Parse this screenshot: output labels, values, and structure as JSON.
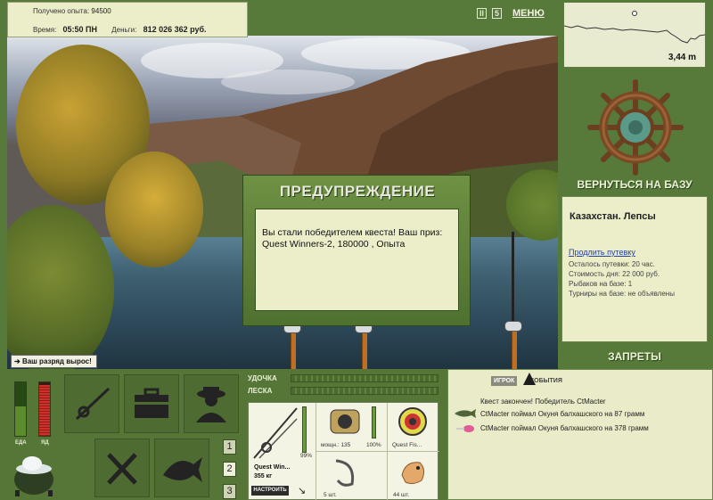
{
  "info": {
    "experience_label": "Получено опыта:",
    "experience_value": "94500",
    "time_label": "Время:",
    "time_value": "05:50 ПН",
    "money_label": "Деньги:",
    "money_value": "812 026 362 руб."
  },
  "top_icons": {
    "pause": "II",
    "sound": "5",
    "menu": "МЕНЮ"
  },
  "depth": {
    "value": "3,44 m"
  },
  "right_panel": {
    "return_base": "ВЕРНУТЬСЯ НА БАЗУ",
    "location": "Казахстан. Лепсы",
    "extend_pass": "Продлить путевку",
    "remaining": "Осталось путевки: 20 час.",
    "day_cost": "Стоимость дня: 22 000 руб.",
    "fishers": "Рыбаков на базе: 1",
    "tournaments": "Турниры на базе: не объявлены",
    "bans": "ЗАПРЕТЫ"
  },
  "dialog": {
    "title": "ПРЕДУПРЕЖДЕНИЕ",
    "message": "Вы стали победителем квеста! Ваш приз: Quest Winners-2, 180000 , Опыта"
  },
  "rank_toast": "Ваш разряд вырос!",
  "gauges": {
    "food_label": "ЕДА",
    "poison_label": "ЯД",
    "food_level": 0.55,
    "poison_level": 0.95
  },
  "num_buttons": [
    "1",
    "2",
    "3"
  ],
  "rod_panel": {
    "rod_label": "УДОЧКА",
    "line_label": "ЛЕСКА",
    "rod_name": "Quest Win...",
    "rod_weight": "355 кг",
    "rod_percent": "99%",
    "reel_power": "мощн.: 135",
    "reel_percent": "100%",
    "lure_name": "Quest Fis...",
    "hook_count": "5 шт.",
    "bait_count": "44 шт.",
    "setup_button": "НАСТРОИТЬ"
  },
  "events": {
    "tab_player": "ИГРОК",
    "tab_events": "СОБЫТИЯ",
    "items": [
      "Квест закончен! Победитель CtMacter",
      "CtMacter поймал Окуня балхашского на 87 грамм",
      "CtMacter поймал Окуня балхашского на 378 грамм"
    ]
  },
  "colors": {
    "panel_green": "#577a3a",
    "cream": "#ecedc9",
    "link_blue": "#1f3fb0"
  }
}
